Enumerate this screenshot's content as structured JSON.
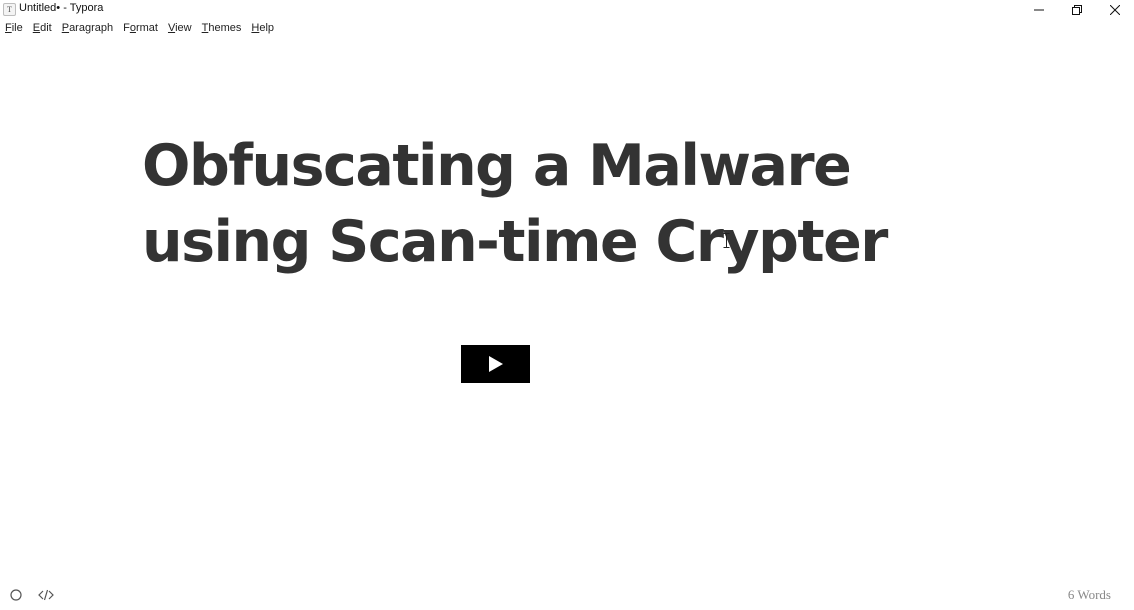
{
  "window": {
    "app_icon_letter": "T",
    "title": "Untitled• - Typora"
  },
  "menu": {
    "items": [
      {
        "accel": "F",
        "rest": "ile"
      },
      {
        "accel": "E",
        "rest": "dit"
      },
      {
        "accel": "P",
        "rest": "aragraph"
      },
      {
        "accel": "F",
        "rest": "ormat",
        "accel_index": 1
      },
      {
        "accel": "V",
        "rest": "iew"
      },
      {
        "accel": "T",
        "rest": "hemes"
      },
      {
        "accel": "H",
        "rest": "elp"
      }
    ]
  },
  "document": {
    "title": "Obfuscating a Malware using Scan-time Crypter"
  },
  "video": {
    "icon": "play-icon"
  },
  "status": {
    "word_count": "6 Words",
    "left_icons": [
      "outline-icon",
      "source-code-icon"
    ]
  },
  "colors": {
    "heading": "#333333",
    "video_bg": "#000000",
    "status_text": "#888888"
  }
}
